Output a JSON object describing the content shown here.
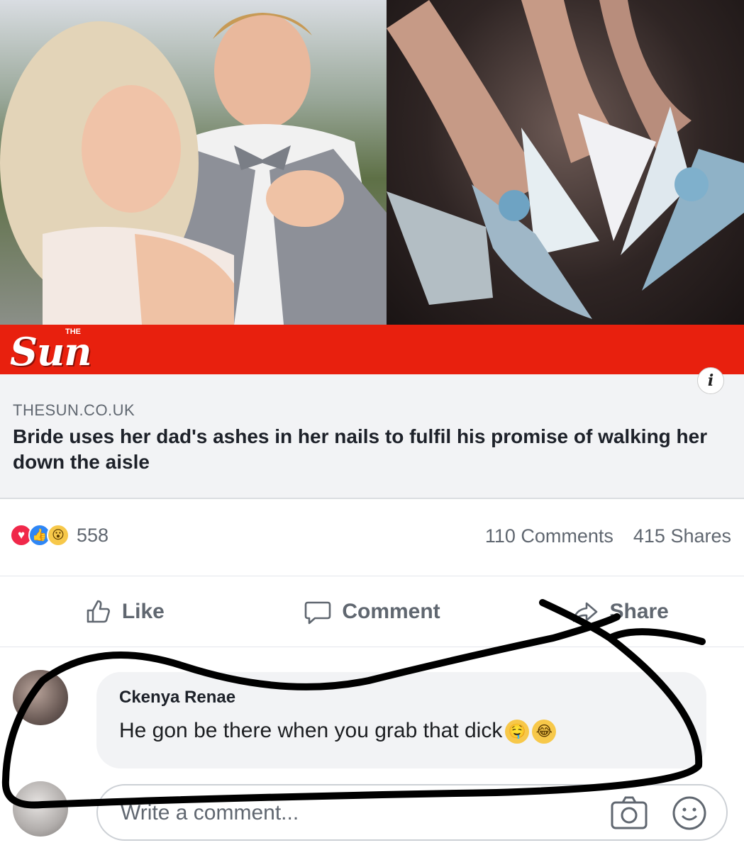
{
  "post": {
    "brand": {
      "logo_small": "THE",
      "logo_text": "Sun"
    },
    "link_card": {
      "domain": "THESUN.CO.UK",
      "headline": "Bride uses her dad's ashes in her nails to fulfil his promise of walking her down the aisle",
      "info_label": "i"
    },
    "stats": {
      "reaction_icons": [
        "love-icon",
        "like-icon",
        "wow-icon"
      ],
      "reaction_count": "558",
      "comments": "110 Comments",
      "shares": "415 Shares"
    },
    "actions": {
      "like": "Like",
      "comment": "Comment",
      "share": "Share"
    }
  },
  "comment": {
    "author": "Ckenya Renae",
    "text": "He gon be there when you grab that dick"
  },
  "composer": {
    "placeholder": "Write a comment..."
  },
  "colors": {
    "brand_red": "#e8200e",
    "card_bg": "#f2f3f5",
    "muted_text": "#606770",
    "scribble": "#000000"
  }
}
